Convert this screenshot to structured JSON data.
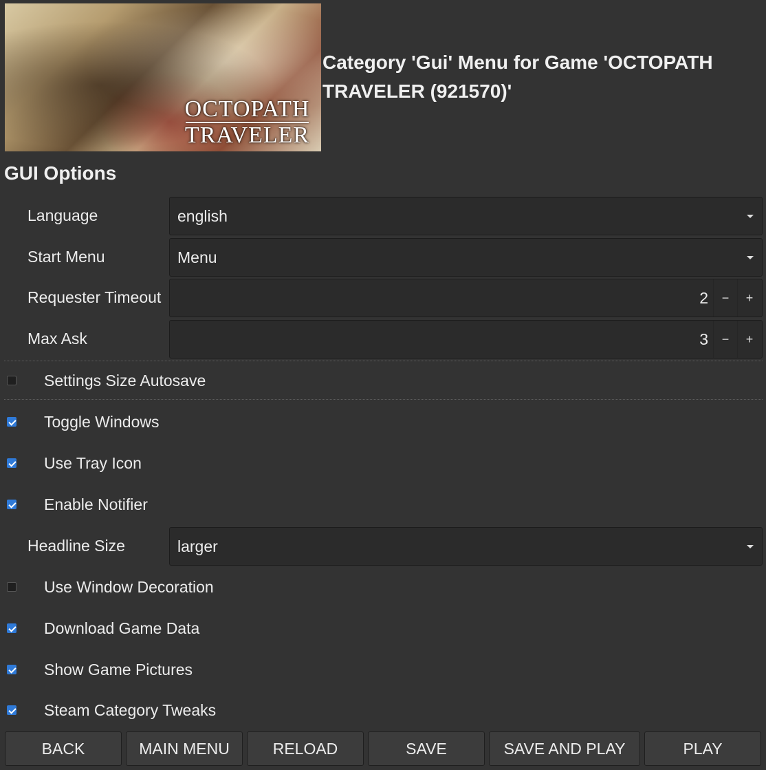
{
  "header": {
    "cover_logo_line1": "OCTOPATH",
    "cover_logo_line2": "TRAVELER",
    "title": "Category 'Gui' Menu for Game 'OCTOPATH TRAVELER (921570)'"
  },
  "section_title": "GUI Options",
  "fields": {
    "language": {
      "label": "Language",
      "value": "english"
    },
    "start_menu": {
      "label": "Start Menu",
      "value": "Menu"
    },
    "requester_timeout": {
      "label": "Requester Timeout",
      "value": "2",
      "minus": "−",
      "plus": "+"
    },
    "max_ask": {
      "label": "Max Ask",
      "value": "3",
      "minus": "−",
      "plus": "+"
    },
    "headline_size": {
      "label": "Headline Size",
      "value": "larger"
    }
  },
  "checkboxes": {
    "settings_size_autosave": {
      "label": "Settings Size Autosave",
      "checked": false
    },
    "toggle_windows": {
      "label": "Toggle Windows",
      "checked": true
    },
    "use_tray_icon": {
      "label": "Use Tray Icon",
      "checked": true
    },
    "enable_notifier": {
      "label": "Enable Notifier",
      "checked": true
    },
    "use_window_decoration": {
      "label": "Use Window Decoration",
      "checked": false
    },
    "download_game_data": {
      "label": "Download Game Data",
      "checked": true
    },
    "show_game_pictures": {
      "label": "Show Game Pictures",
      "checked": true
    },
    "steam_category_tweaks": {
      "label": "Steam Category Tweaks",
      "checked": true
    }
  },
  "buttons": {
    "back": "BACK",
    "main_menu": "MAIN MENU",
    "reload": "RELOAD",
    "save": "SAVE",
    "save_and_play": "SAVE AND PLAY",
    "play": "PLAY"
  },
  "colors": {
    "background": "#333333",
    "field": "#2b2b2b",
    "checkbox_accent": "#2f7ad8"
  }
}
